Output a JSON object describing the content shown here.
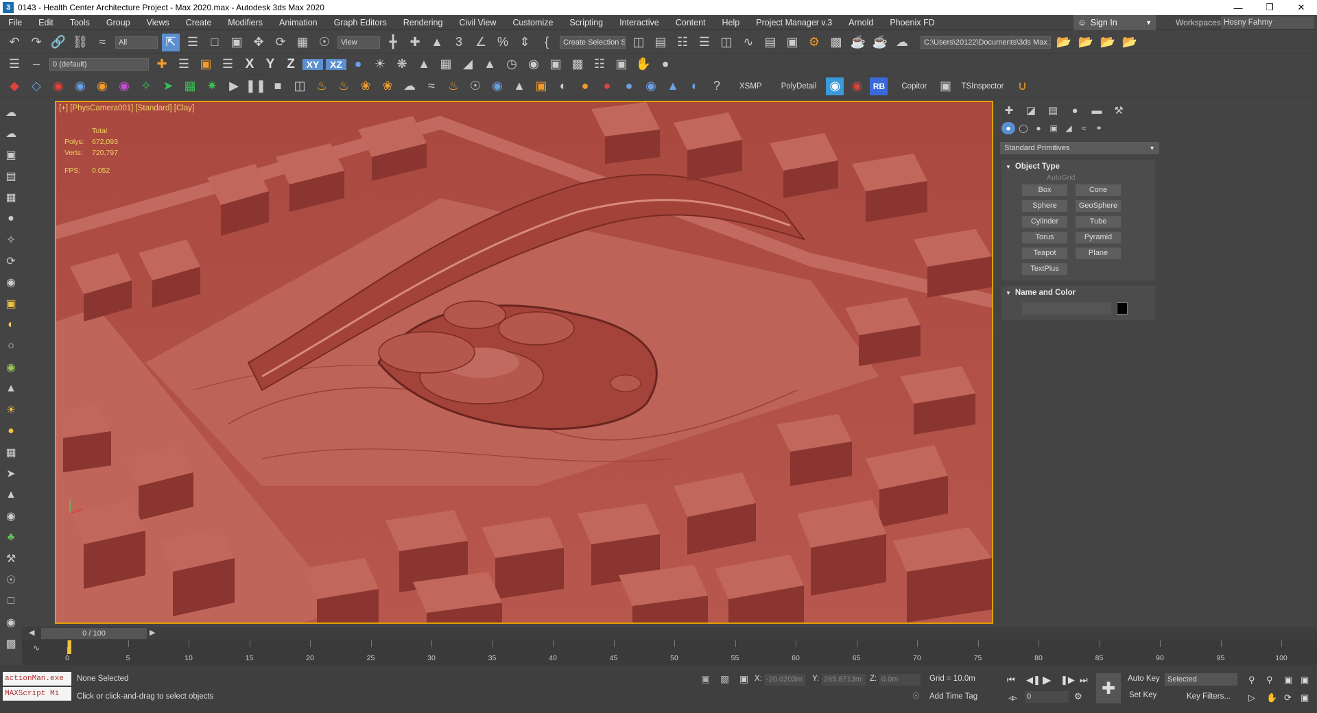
{
  "window": {
    "title": "0143 - Health Center Architecture Project - Max 2020.max - Autodesk 3ds Max 2020",
    "app_icon": "3",
    "minimize": "—",
    "maximize": "❐",
    "close": "✕"
  },
  "menu": [
    "File",
    "Edit",
    "Tools",
    "Group",
    "Views",
    "Create",
    "Modifiers",
    "Animation",
    "Graph Editors",
    "Rendering",
    "Civil View",
    "Customize",
    "Scripting",
    "Interactive",
    "Content",
    "Help",
    "Project Manager v.3",
    "Arnold",
    "Phoenix FD"
  ],
  "account": {
    "signin": "Sign In",
    "workspaces_label": "Workspaces:",
    "workspace": "Hosny Fahmy"
  },
  "toolbar": {
    "filter": "All",
    "ref_coord": "View",
    "selection_set": "Create Selection Se",
    "project_path": "C:\\Users\\20122\\Documents\\3ds Max 2020",
    "layer": "0 (default)",
    "axis_x": "X",
    "axis_y": "Y",
    "axis_z": "Z",
    "axis_xy": "XY",
    "axis_xz": "XZ",
    "xsmp": "XSMP",
    "polydetail": "PolyDetail",
    "rb": "RB",
    "copitor": "Copitor",
    "tsinspector": "TSInspector"
  },
  "viewport": {
    "label": "[+] [PhysCamera001] [Standard] [Clay]",
    "stats": {
      "total_label": "Total",
      "polys_label": "Polys:",
      "polys": "672,093",
      "verts_label": "Verts:",
      "verts": "720,797",
      "fps_label": "FPS:",
      "fps": "0.052"
    },
    "clay_color": "#b2524a"
  },
  "command_panel": {
    "category": "Standard Primitives",
    "object_type": "Object Type",
    "autogrid": "AutoGrid",
    "objects": [
      "Box",
      "Cone",
      "Sphere",
      "GeoSphere",
      "Cylinder",
      "Tube",
      "Torus",
      "Pyramid",
      "Teapot",
      "Plane",
      "TextPlus"
    ],
    "name_color": "Name and Color"
  },
  "timeline": {
    "frame": "0 / 100",
    "ticks": [
      "0",
      "5",
      "10",
      "15",
      "20",
      "25",
      "30",
      "35",
      "40",
      "45",
      "50",
      "55",
      "60",
      "65",
      "70",
      "75",
      "80",
      "85",
      "90",
      "95",
      "100"
    ]
  },
  "status": {
    "maxscript_1": "actionMan.exe",
    "maxscript_2": "MAXScript Mi",
    "selection": "None Selected",
    "prompt": "Click or click-and-drag to select objects",
    "x_label": "X:",
    "x": "-20.0203m",
    "y_label": "Y:",
    "y": "265.8713m",
    "z_label": "Z:",
    "z": "0.0m",
    "grid": "Grid = 10.0m",
    "add_time_tag": "Add Time Tag",
    "auto_key": "Auto Key",
    "set_key": "Set Key",
    "key_mode": "Selected",
    "key_filters": "Key Filters...",
    "current_frame": "0"
  }
}
